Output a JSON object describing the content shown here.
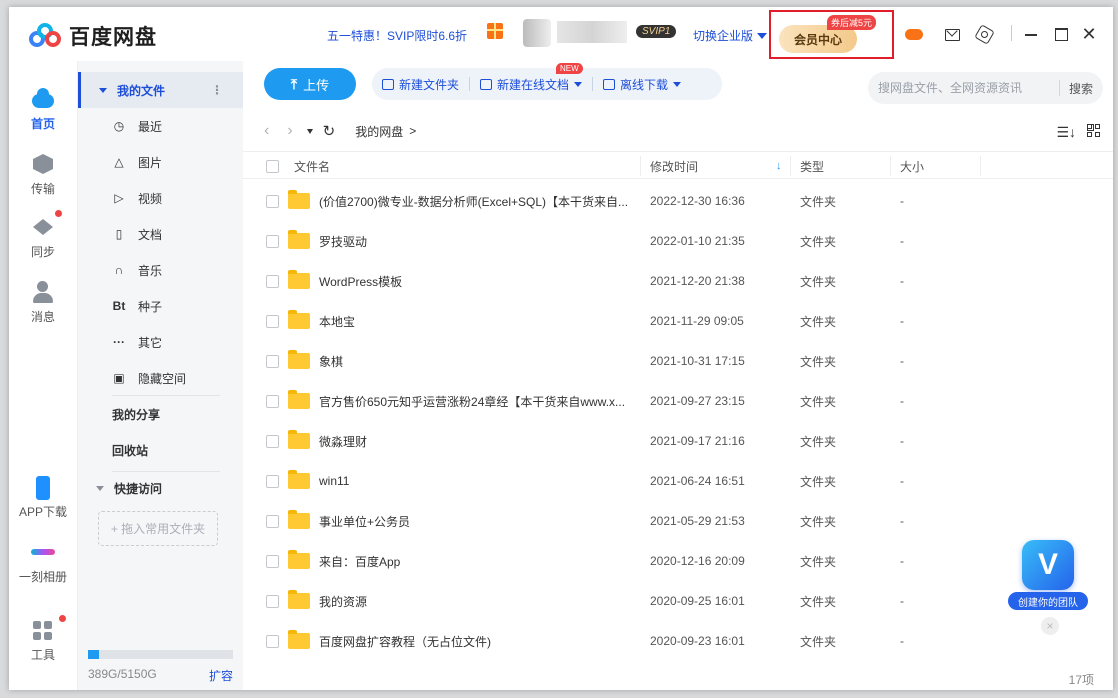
{
  "app": {
    "logo_text": "百度网盘"
  },
  "titlebar": {
    "promo": "五一特惠！SVIP限时6.6折",
    "svip_badge": "SVIP1",
    "enterprise": "切换企业版",
    "vip_center": "会员中心",
    "vip_tag": "券后减5元"
  },
  "nav": {
    "home": "首页",
    "transfer": "传输",
    "sync": "同步",
    "message": "消息",
    "app_download": "APP下载",
    "photo": "一刻相册",
    "tools": "工具"
  },
  "sidebar": {
    "my_files": "我的文件",
    "items": [
      "最近",
      "图片",
      "视频",
      "文档",
      "音乐",
      "种子",
      "其它",
      "隐藏空间"
    ],
    "item_icons": [
      "clock-icon",
      "image-icon",
      "video-icon",
      "doc-icon",
      "music-icon",
      "torrent-icon",
      "more-icon",
      "lock-icon"
    ],
    "item_glyphs": [
      "◷",
      "△",
      "▷",
      "▯",
      "∩",
      "Bt",
      "···",
      "▣"
    ],
    "my_share": "我的分享",
    "recycle": "回收站",
    "quick_access": "快捷访问",
    "quick_drop": "+ 拖入常用文件夹",
    "storage_text": "389G/5150G",
    "storage_fraction": 0.076,
    "expand": "扩容"
  },
  "toolbar": {
    "upload": "上传",
    "new_folder": "新建文件夹",
    "new_doc": "新建在线文档",
    "new_tag": "NEW",
    "offline_download": "离线下载",
    "search_placeholder": "搜网盘文件、全网资源资讯",
    "search_button": "搜索"
  },
  "path": {
    "crumb": "我的网盘",
    "sep": ">"
  },
  "table": {
    "headers": {
      "name": "文件名",
      "time": "修改时间",
      "type": "类型",
      "size": "大小"
    },
    "rows": [
      {
        "name": "(价值2700)微专业-数据分析师(Excel+SQL)【本干货来自...",
        "time": "2022-12-30 16:36",
        "type": "文件夹",
        "size": "-"
      },
      {
        "name": "罗技驱动",
        "time": "2022-01-10 21:35",
        "type": "文件夹",
        "size": "-"
      },
      {
        "name": "WordPress模板",
        "time": "2021-12-20 21:38",
        "type": "文件夹",
        "size": "-"
      },
      {
        "name": "本地宝",
        "time": "2021-11-29 09:05",
        "type": "文件夹",
        "size": "-"
      },
      {
        "name": "象棋",
        "time": "2021-10-31 17:15",
        "type": "文件夹",
        "size": "-"
      },
      {
        "name": "官方售价650元知乎运营涨粉24章经【本干货来自www.x...",
        "time": "2021-09-27 23:15",
        "type": "文件夹",
        "size": "-"
      },
      {
        "name": "微淼理财",
        "time": "2021-09-17 21:16",
        "type": "文件夹",
        "size": "-"
      },
      {
        "name": "win11",
        "time": "2021-06-24 16:51",
        "type": "文件夹",
        "size": "-"
      },
      {
        "name": "事业单位+公务员",
        "time": "2021-05-29 21:53",
        "type": "文件夹",
        "size": "-"
      },
      {
        "name": "来自：百度App",
        "time": "2020-12-16 20:09",
        "type": "文件夹",
        "size": "-"
      },
      {
        "name": "我的资源",
        "time": "2020-09-25 16:01",
        "type": "文件夹",
        "size": "-"
      },
      {
        "name": "百度网盘扩容教程（无占位文件)",
        "time": "2020-09-23 16:01",
        "type": "文件夹",
        "size": "-"
      }
    ]
  },
  "footer": {
    "count": "17项"
  },
  "team_badge": {
    "letter": "V",
    "caption": "创建你的团队"
  }
}
